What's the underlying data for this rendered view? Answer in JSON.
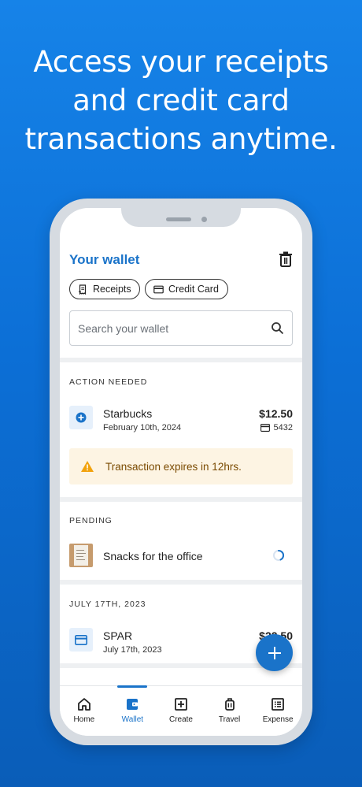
{
  "headline": {
    "line1": "Access your receipts",
    "line2": "and credit card",
    "line3": "transactions anytime."
  },
  "wallet": {
    "title": "Your wallet",
    "trash_icon": "trash-icon"
  },
  "filters": {
    "receipts_label": "Receipts",
    "credit_card_label": "Credit Card"
  },
  "search": {
    "placeholder": "Search your wallet",
    "icon": "search-icon"
  },
  "sections": {
    "action_needed": {
      "label": "ACTION NEEDED",
      "item": {
        "merchant": "Starbucks",
        "date": "February 10th, 2024",
        "amount": "$12.50",
        "card_last4": "5432",
        "icon": "add-circle-icon"
      },
      "warning": {
        "text": "Transaction expires in 12hrs.",
        "icon": "warning-icon",
        "color": "#f2a20c"
      }
    },
    "pending": {
      "label": "PENDING",
      "item": {
        "title": "Snacks for the office",
        "icon": "receipt-thumbnail",
        "status_icon": "loading-spinner-icon"
      }
    },
    "dated": {
      "label": "JULY 17TH, 2023",
      "item": {
        "merchant": "SPAR",
        "date": "July 17th, 2023",
        "amount": "$22.50",
        "icon": "credit-card-icon"
      }
    }
  },
  "fab": {
    "icon": "plus-icon"
  },
  "tabs": [
    {
      "label": "Home",
      "icon": "home-icon",
      "active": false
    },
    {
      "label": "Wallet",
      "icon": "wallet-icon",
      "active": true
    },
    {
      "label": "Create",
      "icon": "add-box-icon",
      "active": false
    },
    {
      "label": "Travel",
      "icon": "luggage-icon",
      "active": false
    },
    {
      "label": "Expense",
      "icon": "expense-list-icon",
      "active": false
    }
  ],
  "colors": {
    "accent": "#1a73c9",
    "background_top": "#1683e8",
    "background_bottom": "#0a5db8",
    "warning_bg": "#fdf4e3"
  }
}
